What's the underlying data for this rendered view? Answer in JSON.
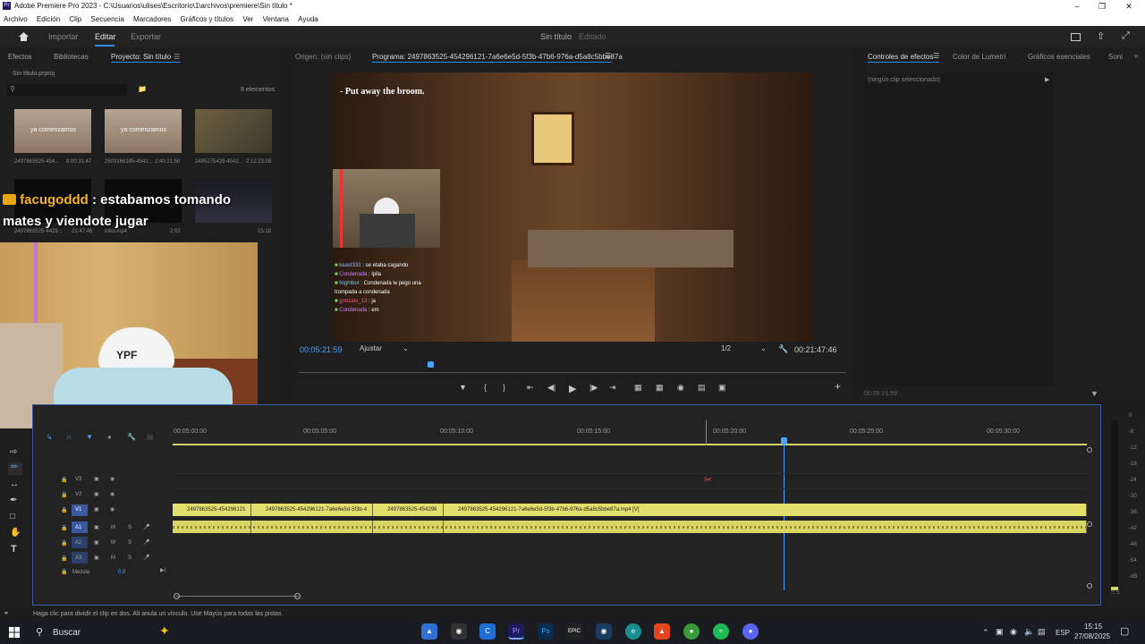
{
  "window": {
    "title": "Adobe Premiere Pro 2023 - C:\\Usuarios\\ulises\\Escritorio\\1\\archivos\\premiere\\Sin título *",
    "app_badge": "Pr"
  },
  "menu": [
    "Archivo",
    "Edición",
    "Clip",
    "Secuencia",
    "Marcadores",
    "Gráficos y títulos",
    "Ver",
    "Ventana",
    "Ayuda"
  ],
  "header": {
    "tabs": [
      "Importar",
      "Editar",
      "Exportar"
    ],
    "project_title": "Sin título",
    "project_state": "Editado"
  },
  "left_panel": {
    "tabs": [
      "Efectos",
      "Bibliotecas",
      "Proyecto: Sin título"
    ],
    "project_file": "Sin título.prproj",
    "item_count": "8 elementos",
    "items": [
      {
        "name": "2497863525-454...",
        "duration": "8:00:31:47"
      },
      {
        "name": "2503166185-4542...",
        "duration": "2:40:21:50"
      },
      {
        "name": "2495275429-4542...",
        "duration": "2:12:23:08"
      },
      {
        "name": "2497863525-4429...",
        "duration": "21:47:46"
      },
      {
        "name": "intro.mp4",
        "duration": "2:02"
      },
      {
        "name": "",
        "duration": "15:18"
      }
    ],
    "thumb_overlay": "ya comenzamos"
  },
  "overlay_chat": {
    "user": "facugoddd",
    "message": ": estabamos tomando mates y viendote jugar",
    "cap_text": "YPF"
  },
  "source_monitor": {
    "label": "Origen: (sin clips)"
  },
  "program_monitor": {
    "label": "Programa: 2497863525-454296121-7a6e6e5d-5f3b-47b6-976a-d5a8c5bbe87a",
    "caption": "- Put away the broom.",
    "chat": [
      {
        "user": "kaast333",
        "msg": ": se etaba cagando"
      },
      {
        "user": "Condenada",
        "msg": ": lpila"
      },
      {
        "user": "Nightbot",
        "msg": ": Condenada le pego una trompada a condenada"
      },
      {
        "user": "gonzalo_13",
        "msg": ": ja"
      },
      {
        "user": "Condenada",
        "msg": ": em"
      }
    ],
    "timecode": "00:05:21:59",
    "fit": "Ajustar",
    "resolution": "1/2",
    "duration": "00:21:47:46"
  },
  "right_panel": {
    "tabs": [
      "Controles de efectos",
      "Color de Lumetri",
      "Gráficos esenciales",
      "Soni"
    ],
    "no_clip": "(ningún clip seleccionado)",
    "timecode": "00:05:21:59"
  },
  "timeline": {
    "ruler": [
      "00:05:00:00",
      "00:05:05:00",
      "00:05:10:00",
      "00:05:15:00",
      "00:05:20:00",
      "00:05:25:00",
      "00:05:30:00"
    ],
    "tracks_video": [
      "V3",
      "V2",
      "V1"
    ],
    "tracks_audio": [
      "A1",
      "A2",
      "A3"
    ],
    "mix_label": "Mezcla",
    "mix_value": "0,0",
    "clips": [
      {
        "label": "2497863525-454296121"
      },
      {
        "label": "2497863525-454296121-7a6e6e5d-5f3b-4"
      },
      {
        "label": "2497863525-454296"
      },
      {
        "label": "2497863525-454296121-7a6e6e5d-5f3b-47b6-976a-d5a8c5bbe87a.mp4 [V]"
      }
    ]
  },
  "meter": {
    "scale": [
      "0",
      "-6",
      "-12",
      "-18",
      "-24",
      "-30",
      "-36",
      "-42",
      "-48",
      "-54",
      "-dB"
    ],
    "solo": "S S"
  },
  "status": "Haga clic para dividir el clip en dos. Alt anula un vínculo. Use Mayús para todas las pistas.",
  "taskbar": {
    "search": "Buscar",
    "lang": "ESP",
    "time": "15:15",
    "date": "27/08/2025",
    "apps": [
      "premiere",
      "photoshop",
      "epic",
      "steam",
      "edge",
      "brave",
      "chrome",
      "spotify",
      "discord"
    ],
    "app_labels": {
      "premiere": "Pr",
      "photoshop": "Ps",
      "epic": "EPIC"
    }
  }
}
